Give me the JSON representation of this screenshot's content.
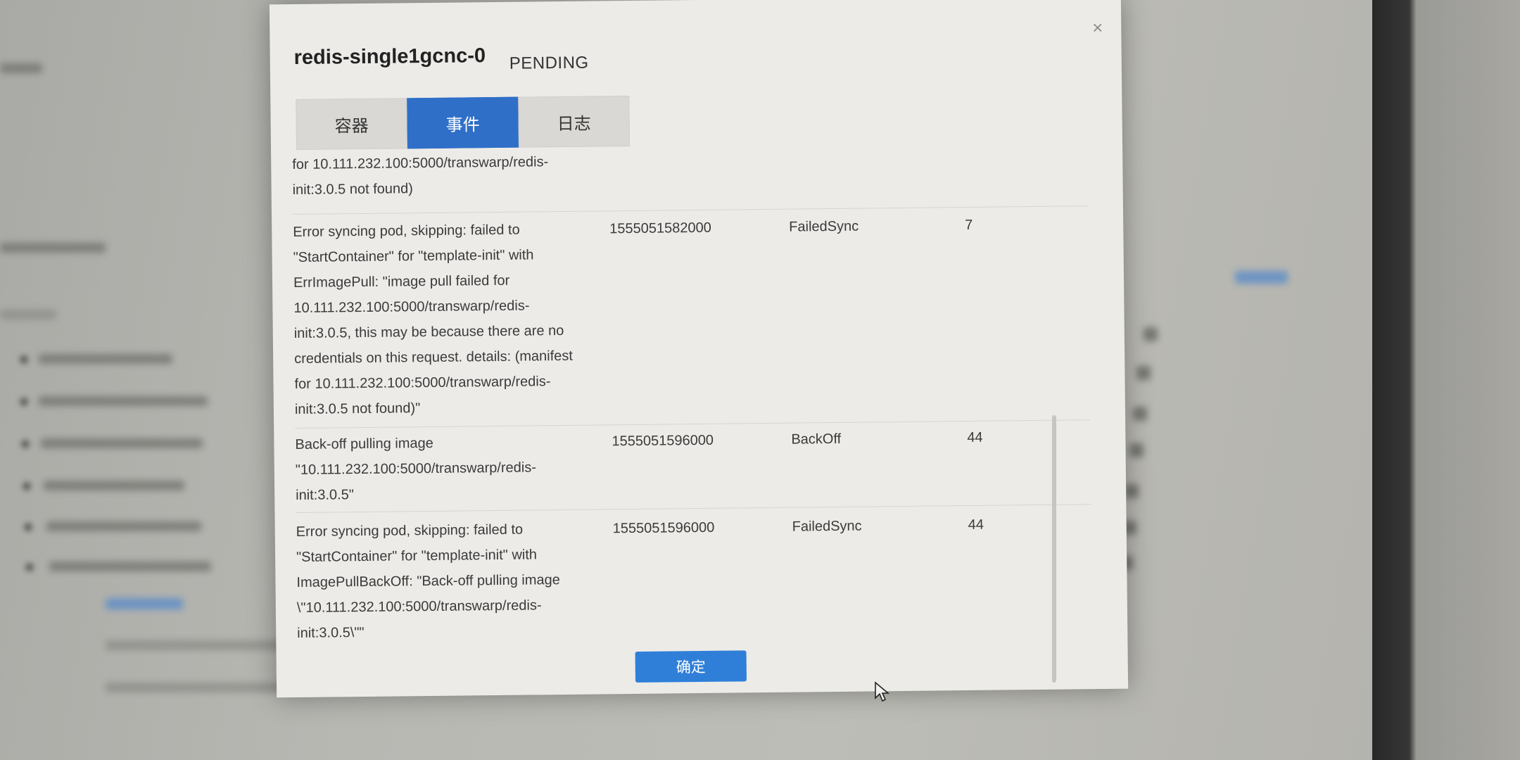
{
  "modal": {
    "pod_name": "redis-single1gcnc-0",
    "status": "PENDING",
    "close_glyph": "×",
    "tabs": [
      {
        "label": "容器",
        "active": false
      },
      {
        "label": "事件",
        "active": true
      },
      {
        "label": "日志",
        "active": false
      }
    ],
    "events": [
      {
        "message": "for 10.111.232.100:5000/transwarp/redis-\ninit:3.0.5 not found)",
        "time": "",
        "reason": "",
        "count": ""
      },
      {
        "message": "Error syncing pod, skipping: failed to\n\"StartContainer\" for \"template-init\" with\nErrImagePull: \"image pull failed for\n10.111.232.100:5000/transwarp/redis-\ninit:3.0.5, this may be because there are no\ncredentials on this request. details: (manifest\nfor 10.111.232.100:5000/transwarp/redis-\ninit:3.0.5 not found)\"",
        "time": "1555051582000",
        "reason": "FailedSync",
        "count": "7"
      },
      {
        "message": "Back-off pulling image\n\"10.111.232.100:5000/transwarp/redis-\ninit:3.0.5\"",
        "time": "1555051596000",
        "reason": "BackOff",
        "count": "44"
      },
      {
        "message": "Error syncing pod, skipping: failed to\n\"StartContainer\" for \"template-init\" with\nImagePullBackOff: \"Back-off pulling image\n\\\"10.111.232.100:5000/transwarp/redis-\ninit:3.0.5\\\"\"",
        "time": "1555051596000",
        "reason": "FailedSync",
        "count": "44"
      }
    ],
    "confirm_label": "确定"
  },
  "colors": {
    "accent": "#2f6fc8",
    "modal_bg": "#ecebe8"
  }
}
